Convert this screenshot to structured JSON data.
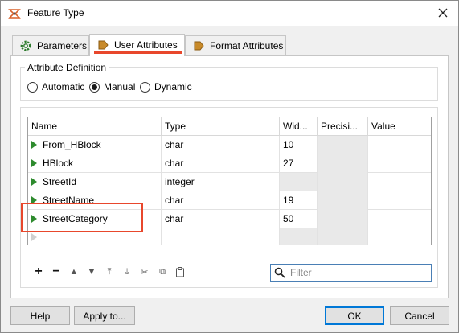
{
  "window": {
    "title": "Feature Type"
  },
  "tabs": [
    {
      "label": "Parameters",
      "icon": "gear-icon"
    },
    {
      "label": "User Attributes",
      "icon": "attribute-arrow-icon"
    },
    {
      "label": "Format Attributes",
      "icon": "attribute-arrow-icon"
    }
  ],
  "attribute_definition": {
    "legend": "Attribute Definition",
    "options": [
      "Automatic",
      "Manual",
      "Dynamic"
    ],
    "selected": "Manual"
  },
  "table": {
    "columns": [
      "Name",
      "Type",
      "Wid...",
      "Precisi...",
      "Value"
    ],
    "rows": [
      {
        "name": "From_HBlock",
        "type": "char",
        "width": "10",
        "precision": "",
        "value": ""
      },
      {
        "name": "HBlock",
        "type": "char",
        "width": "27",
        "precision": "",
        "value": ""
      },
      {
        "name": "StreetId",
        "type": "integer",
        "width": "",
        "precision": "",
        "value": ""
      },
      {
        "name": "StreetName",
        "type": "char",
        "width": "19",
        "precision": "",
        "value": ""
      },
      {
        "name": "StreetCategory",
        "type": "char",
        "width": "50",
        "precision": "",
        "value": ""
      }
    ]
  },
  "toolbar": {
    "items": [
      {
        "name": "add-icon",
        "glyph": "+"
      },
      {
        "name": "remove-icon",
        "glyph": "−"
      },
      {
        "name": "move-up-icon",
        "glyph": "▲"
      },
      {
        "name": "move-down-icon",
        "glyph": "▼"
      },
      {
        "name": "move-to-top-icon",
        "glyph": "⤒"
      },
      {
        "name": "move-to-bottom-icon",
        "glyph": "⤓"
      },
      {
        "name": "cut-icon",
        "glyph": "✂"
      },
      {
        "name": "copy-icon",
        "glyph": "⧉"
      },
      {
        "name": "paste-icon",
        "glyph": "📋"
      }
    ]
  },
  "filter": {
    "placeholder": "Filter",
    "value": ""
  },
  "buttons": {
    "help": "Help",
    "apply_to": "Apply to...",
    "ok": "OK",
    "cancel": "Cancel"
  },
  "colors": {
    "highlight": "#e8472c",
    "accent": "#0078d7",
    "row_arrow": "#2e8b2e"
  }
}
